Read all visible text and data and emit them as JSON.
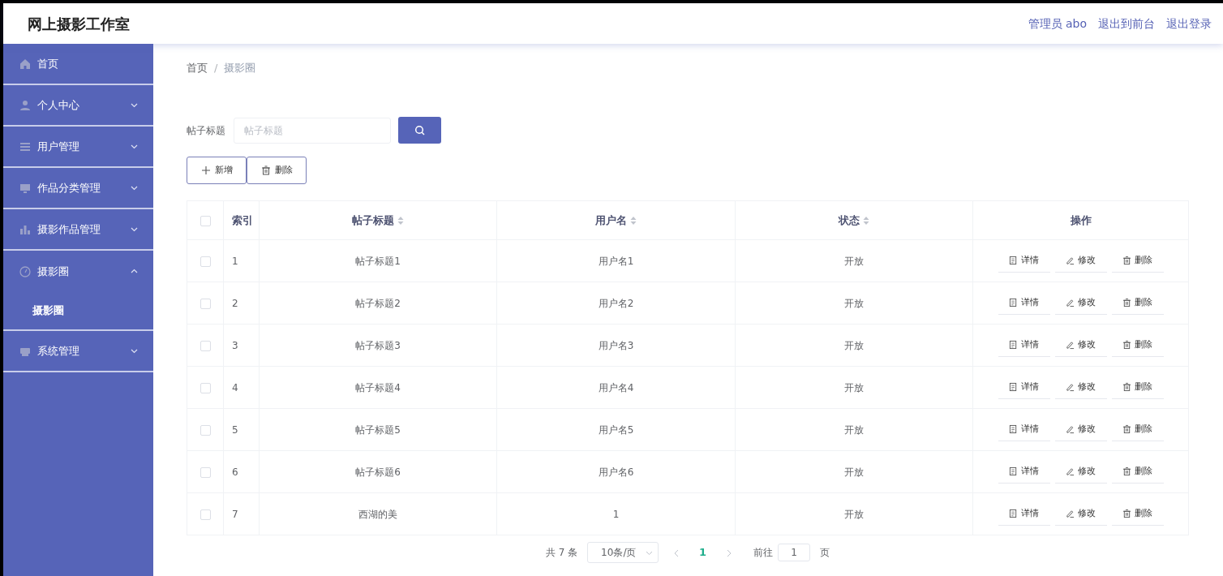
{
  "header": {
    "title": "网上摄影工作室",
    "links": [
      "管理员 abo",
      "退出到前台",
      "退出登录"
    ]
  },
  "sidebar": {
    "items": [
      {
        "label": "首页"
      },
      {
        "label": "个人中心",
        "expanded": false
      },
      {
        "label": "用户管理",
        "expanded": false
      },
      {
        "label": "作品分类管理",
        "expanded": false
      },
      {
        "label": "摄影作品管理",
        "expanded": false
      },
      {
        "label": "摄影圈",
        "expanded": true,
        "children": [
          {
            "label": "摄影圈"
          }
        ]
      },
      {
        "label": "系统管理",
        "expanded": false
      }
    ]
  },
  "breadcrumb": {
    "separator": "/",
    "items": [
      "首页",
      "摄影圈"
    ]
  },
  "search": {
    "label": "帖子标题",
    "placeholder": "帖子标题"
  },
  "toolbar": [
    "新增",
    "删除"
  ],
  "table": {
    "columns": [
      {
        "label": "索引",
        "sortable": false
      },
      {
        "label": "帖子标题",
        "sortable": true
      },
      {
        "label": "用户名",
        "sortable": true
      },
      {
        "label": "状态",
        "sortable": true
      },
      {
        "label": "操作",
        "sortable": false
      }
    ],
    "all_checked": false,
    "rows": [
      {
        "checked": false,
        "cells": [
          "1",
          "帖子标题1",
          "用户名1",
          "开放"
        ],
        "actions": [
          "详情",
          "修改",
          "删除"
        ]
      },
      {
        "checked": false,
        "cells": [
          "2",
          "帖子标题2",
          "用户名2",
          "开放"
        ],
        "actions": [
          "详情",
          "修改",
          "删除"
        ]
      },
      {
        "checked": false,
        "cells": [
          "3",
          "帖子标题3",
          "用户名3",
          "开放"
        ],
        "actions": [
          "详情",
          "修改",
          "删除"
        ]
      },
      {
        "checked": false,
        "cells": [
          "4",
          "帖子标题4",
          "用户名4",
          "开放"
        ],
        "actions": [
          "详情",
          "修改",
          "删除"
        ]
      },
      {
        "checked": false,
        "cells": [
          "5",
          "帖子标题5",
          "用户名5",
          "开放"
        ],
        "actions": [
          "详情",
          "修改",
          "删除"
        ]
      },
      {
        "checked": false,
        "cells": [
          "6",
          "帖子标题6",
          "用户名6",
          "开放"
        ],
        "actions": [
          "详情",
          "修改",
          "删除"
        ]
      },
      {
        "checked": false,
        "cells": [
          "7",
          "西湖的美",
          "1",
          "开放"
        ],
        "actions": [
          "详情",
          "修改",
          "删除"
        ]
      }
    ]
  },
  "pagination": {
    "total": "共 7 条",
    "page_size": "10条/页",
    "pages": [
      {
        "label": "1",
        "selected": true
      }
    ],
    "goto_label": "前往",
    "goto_value": "1",
    "goto_suffix": "页"
  }
}
